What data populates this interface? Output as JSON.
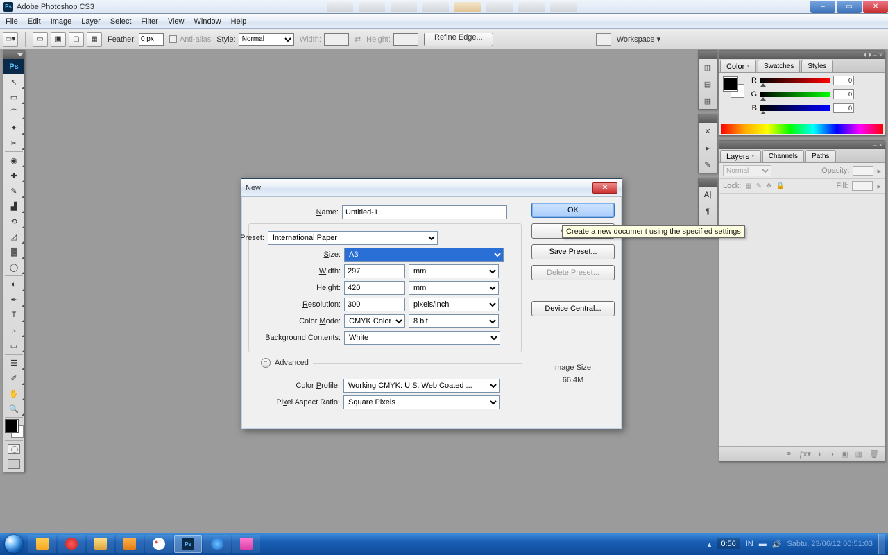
{
  "window": {
    "title": "Adobe Photoshop CS3"
  },
  "winbuttons": {
    "min": "–",
    "max": "▭",
    "close": "✕"
  },
  "menu": [
    "File",
    "Edit",
    "Image",
    "Layer",
    "Select",
    "Filter",
    "View",
    "Window",
    "Help"
  ],
  "options": {
    "feather_label": "Feather:",
    "feather_val": "0 px",
    "antialias": "Anti-alias",
    "style_label": "Style:",
    "style_val": "Normal",
    "width_label": "Width:",
    "height_label": "Height:",
    "refine": "Refine Edge...",
    "workspace": "Workspace ▾"
  },
  "toolbox": {
    "logo": "Ps",
    "tools": [
      {
        "g": "↖",
        "n": "move-tool"
      },
      {
        "g": "▭",
        "n": "marquee-tool",
        "sel": true
      },
      {
        "g": "⌒",
        "n": "lasso-tool"
      },
      {
        "g": "✦",
        "n": "wand-tool"
      },
      {
        "g": "✂",
        "n": "crop-tool"
      },
      {
        "g": "◉",
        "n": "slice-tool"
      },
      {
        "g": "✚",
        "n": "healing-tool"
      },
      {
        "g": "✎",
        "n": "brush-tool"
      },
      {
        "g": "▟",
        "n": "stamp-tool"
      },
      {
        "g": "⟲",
        "n": "history-brush-tool"
      },
      {
        "g": "◿",
        "n": "eraser-tool"
      },
      {
        "g": "▓",
        "n": "gradient-tool"
      },
      {
        "g": "◯",
        "n": "blur-tool"
      },
      {
        "g": "◐",
        "n": "dodge-tool"
      },
      {
        "g": "✒",
        "n": "pen-tool"
      },
      {
        "g": "T",
        "n": "type-tool"
      },
      {
        "g": "▹",
        "n": "path-select-tool"
      },
      {
        "g": "▭",
        "n": "shape-tool"
      },
      {
        "g": "☰",
        "n": "notes-tool"
      },
      {
        "g": "✐",
        "n": "eyedropper-tool"
      },
      {
        "g": "✋",
        "n": "hand-tool"
      },
      {
        "g": "🔍",
        "n": "zoom-tool"
      }
    ]
  },
  "colorpanel": {
    "tabs": [
      "Color",
      "Swatches",
      "Styles"
    ],
    "r_label": "R",
    "g_label": "G",
    "b_label": "B",
    "r": "0",
    "g": "0",
    "b": "0"
  },
  "layerspanel": {
    "tabs": [
      "Layers",
      "Channels",
      "Paths"
    ],
    "blend": "Normal",
    "opacity_label": "Opacity:",
    "opacity": "",
    "lock_label": "Lock:",
    "fill_label": "Fill:",
    "fill": ""
  },
  "dialog": {
    "title": "New",
    "name_label": "Name:",
    "name_val": "Untitled-1",
    "preset_label": "Preset:",
    "preset_val": "International Paper",
    "size_label": "Size:",
    "size_val": "A3",
    "width_label": "Width:",
    "width_val": "297",
    "width_unit": "mm",
    "height_label": "Height:",
    "height_val": "420",
    "height_unit": "mm",
    "res_label": "Resolution:",
    "res_val": "300",
    "res_unit": "pixels/inch",
    "mode_label": "Color Mode:",
    "mode_val": "CMYK Color",
    "mode_bits": "8 bit",
    "bg_label": "Background Contents:",
    "bg_val": "White",
    "advanced": "Advanced",
    "profile_label": "Color Profile:",
    "profile_val": "Working CMYK:  U.S. Web Coated ...",
    "par_label": "Pixel Aspect Ratio:",
    "par_val": "Square Pixels",
    "ok": "OK",
    "cancel": "Cancel",
    "save_preset": "Save Preset...",
    "delete_preset": "Delete Preset...",
    "device_central": "Device Central...",
    "imgsize_label": "Image Size:",
    "imgsize_val": "66,4M",
    "tooltip": "Create a new document using the specified settings"
  },
  "taskbar": {
    "clock": "0:56",
    "lang": "IN",
    "date": "Sabtu, 23/06/12 00:51:03"
  }
}
